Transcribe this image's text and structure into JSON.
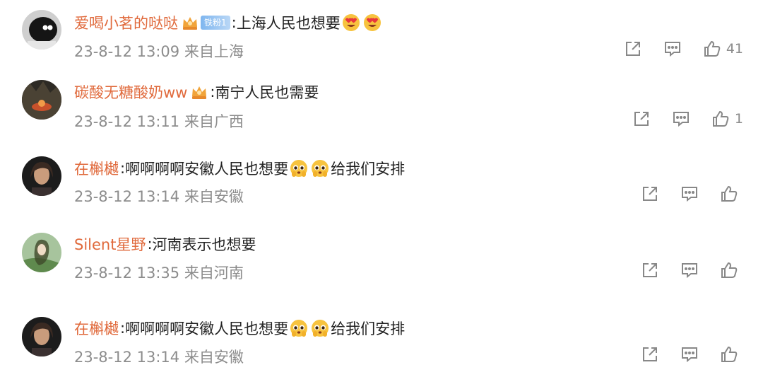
{
  "comments": [
    {
      "username": "爱喝小茗的哒哒",
      "fan_badge": "铁粉1",
      "text": "上海人民也想要",
      "emojis": [
        "heart-eyes-emoji",
        "heart-eyes-emoji"
      ],
      "text_after": "",
      "meta": "23-8-12 13:09 来自上海",
      "like_count": "41"
    },
    {
      "username": "碳酸无糖酸奶ww",
      "text": "南宁人民也需要",
      "meta": "23-8-12 13:11 来自广西",
      "like_count": "1"
    },
    {
      "username": "在槲樾",
      "text": "啊啊啊啊安徽人民也想要",
      "emojis": [
        "pleading-emoji",
        "pleading-emoji"
      ],
      "text_after": "给我们安排",
      "meta": "23-8-12 13:14 来自安徽",
      "like_count": ""
    },
    {
      "username": "Silent星野",
      "text": "河南表示也想要",
      "meta": "23-8-12 13:35 来自河南",
      "like_count": ""
    },
    {
      "username": "在槲樾",
      "text": "啊啊啊啊安徽人民也想要",
      "emojis": [
        "pleading-emoji",
        "pleading-emoji"
      ],
      "text_after": "给我们安排",
      "meta": "23-8-12 13:14 来自安徽",
      "like_count": ""
    }
  ],
  "colors": {
    "username": "#e0693b",
    "text": "#222222",
    "meta": "#8c8c8c",
    "icon": "#888888",
    "fan_badge": "#7fb6ef"
  }
}
